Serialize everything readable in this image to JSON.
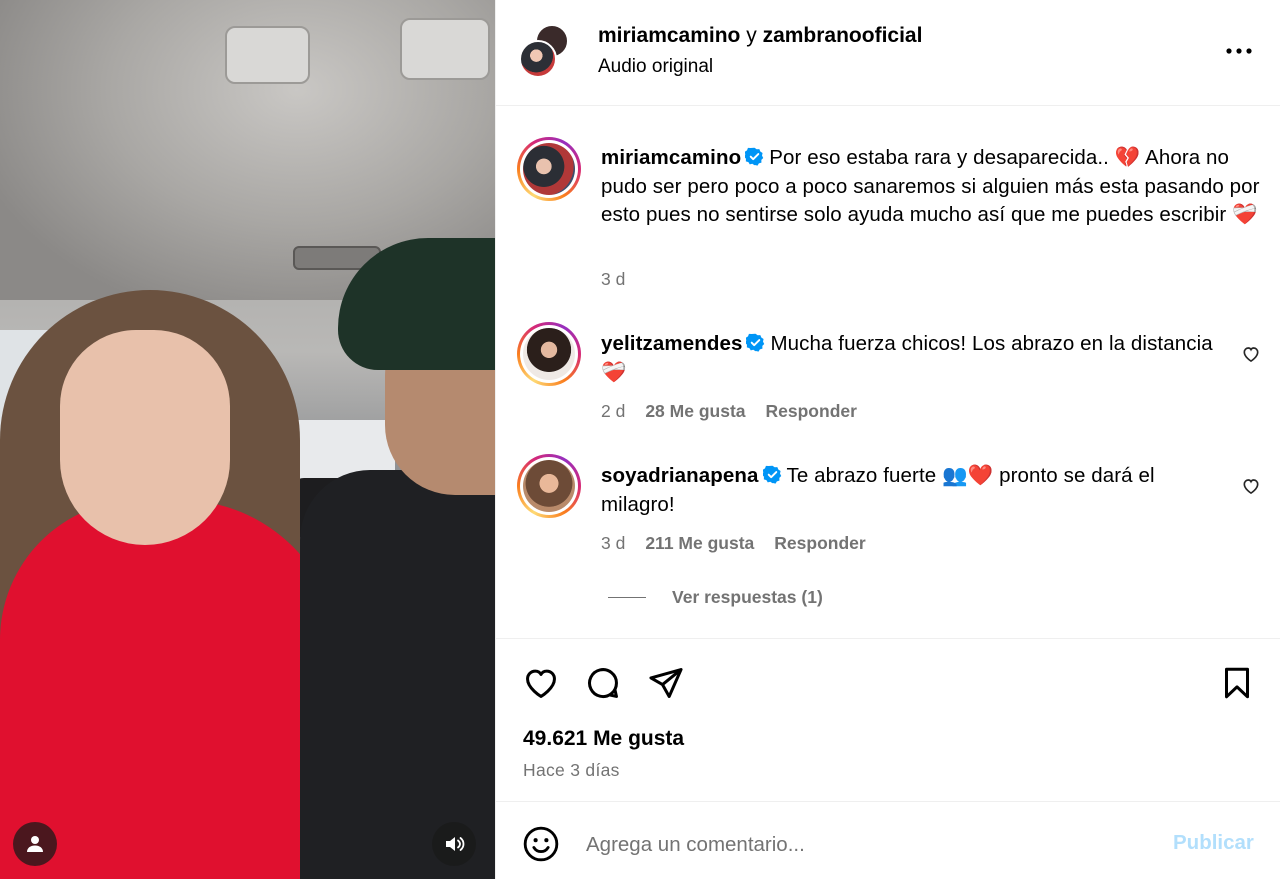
{
  "header": {
    "user1": "miriamcamino",
    "connector": "y",
    "user2": "zambranooficial",
    "subtitle": "Audio original",
    "more_icon": "more-horizontal-icon"
  },
  "caption": {
    "username": "miriamcamino",
    "text": "Por eso estaba rara y desaparecida.. 💔 Ahora no pudo ser pero poco a poco sanaremos si alguien más esta pasando por esto pues no sentirse solo ayuda mucho así que me puedes escribir ❤️‍🩹",
    "time": "3 d"
  },
  "comments": [
    {
      "username": "yelitzamendes",
      "text": "Mucha fuerza chicos! Los abrazo en la distancia ❤️‍🩹",
      "time": "2 d",
      "likes": "28 Me gusta",
      "reply": "Responder"
    },
    {
      "username": "soyadrianapena",
      "text": "Te abrazo fuerte 👥❤️ pronto se dará el milagro!",
      "time": "3 d",
      "likes": "211 Me gusta",
      "reply": "Responder"
    }
  ],
  "view_replies": "Ver respuestas (1)",
  "post": {
    "likes": "49.621 Me gusta",
    "posted": "Hace 3 días"
  },
  "composer": {
    "placeholder": "Agrega un comentario...",
    "publish": "Publicar"
  },
  "colors": {
    "verified": "#0095f6",
    "publish_disabled": "#b2dffc",
    "secondary_text": "#737373"
  }
}
